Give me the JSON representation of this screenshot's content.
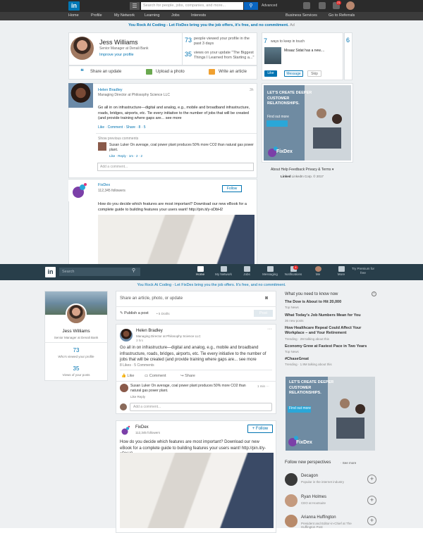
{
  "old": {
    "logo": "in",
    "search_placeholder": "Search for people, jobs, companies, and more...",
    "advanced": "Advanced",
    "nav": [
      "Home",
      "Profile",
      "My Network",
      "Learning",
      "Jobs",
      "Interests"
    ],
    "nav_right": [
      "Business Services",
      "Go to Referrals"
    ],
    "notif_count": "21",
    "promo": "You Rock At Coding - Let FixDex bring you the job offers, it's free, and no commitment.",
    "ad_label": "Ad",
    "profile": {
      "name": "Jess Williams",
      "title": "Senior Manager at Denali Bank",
      "improve": "Improve your profile",
      "stats": [
        {
          "n": "73",
          "t": "people viewed your profile in the past 3 days"
        },
        {
          "n": "35",
          "t": "views on your update \"The Biggest Things I Learned from Starting a...\""
        }
      ]
    },
    "actions": [
      "Share an update",
      "Upload a photo",
      "Write an article"
    ],
    "ways": {
      "n": "7",
      "t": "ways to keep in touch",
      "name": "Moaaz Sidat has a new....",
      "btns": [
        "Like",
        "Message",
        "Skip"
      ],
      "next": "6"
    },
    "post1": {
      "name": "Helen Bradley",
      "role": "Managing Director at Philosophy Science LLC",
      "time": "3h",
      "text": "Go all in on infrastructure—digital and analog, e.g., mobile and broadband infrastructure, roads, bridges, airports, etc. Tie every initiative to the number of jobs that will be created (and provide training where gaps are... see more",
      "meta": "Like  ·  Comment  ·  Share  ·  8  ·  5",
      "show_prev": "Show previous comments",
      "comment": "Susan Luker On average, coal power plant produces 50% more CO2 than natural gas power plant.",
      "comment_meta": "Like · Reply · 1m · 2 · 2",
      "add_comment": "Add a comment..."
    },
    "post2": {
      "name": "FixDex",
      "followers": "112,345 followers",
      "follow": "Follow",
      "text": "How do you decide which features are most important? Download our new eBook for a complete guide to building features your users want! http://pin.it/y-sDbH2"
    },
    "ad": {
      "line": "LET'S CREATE DEEPER CUSTOMER RELATIONSHIPS.",
      "cta": "Find out more",
      "brand": "FixDex"
    },
    "footer": "About   Help   Feedback   Privacy & Terms ▾",
    "copyright_logo": "Linked",
    "copyright": "LinkedIn Corp. © 2017"
  },
  "new": {
    "logo": "in",
    "search_placeholder": "Search",
    "nav": [
      "Home",
      "My Network",
      "Jobs",
      "Messaging",
      "Notifications",
      "Me",
      "More"
    ],
    "notif_count": "4",
    "premium": "Try Premium for free",
    "promo": "You Rock At Coding - Let FixDex bring you the job offers. It's free, and no commitment.",
    "profile": {
      "name": "Jess Williams",
      "title": "Senior Manager at Denali Bank",
      "stats": [
        {
          "n": "73",
          "t": "Who's viewed your profile"
        },
        {
          "n": "35",
          "t": "Views of your posts"
        }
      ]
    },
    "share": {
      "placeholder": "Share an article, photo, or update",
      "publish": "Publish a post",
      "drafts": "• 5 Drafts",
      "post": "Post"
    },
    "post1": {
      "name": "Helen Bradley",
      "role": "Managing Director at Philosophy Science LLC",
      "time": "3 hrs",
      "more": "···",
      "text": "Go all in on infrastructure—digital and analog, e.g., mobile and broadband infrastructure, roads, bridges, airports, etc. Tie every initiative to the number of jobs that will be created (and provide training where gaps are... see more",
      "meta": "8 Likes · 5 Comments",
      "actions": [
        "Like",
        "Comment",
        "Share"
      ],
      "comment": "Susan Luker On average, coal power plant produces 50% more CO2 than natural gas power plant.",
      "comment_time": "1 min  ···",
      "comment_meta": "Like   Reply",
      "add_comment": "Add a comment..."
    },
    "post2": {
      "name": "FixDex",
      "followers": "112,345 followers",
      "follow": "+ Follow",
      "text": "How do you decide which features are most important? Download our new eBook for a complete guide to building features your users want! http://pin.it/y-sDbH2"
    },
    "news": {
      "header": "What you need to know now",
      "info": "i",
      "items": [
        {
          "t": "The Dow is About to Hit 20,000",
          "s": "Top News"
        },
        {
          "t": "What Today's Job Numbers Mean for You",
          "s": "36 new posts"
        },
        {
          "t": "How Healthcare Repeal Could Affect Your Workplace – and Your Retirement",
          "s": "Trending · 2M talking about this"
        },
        {
          "t": "Economy Grew at Fastest Pace in Two Years",
          "s": "Top News"
        },
        {
          "t": "#ChaseGreat",
          "s": "Trending · 1.9M talking about this"
        }
      ]
    },
    "ad": {
      "line": "LET'S CREATE DEEPER CUSTOMER RELATIONSHIPS.",
      "cta": "Find out more",
      "brand": "FixDex"
    },
    "perspectives": {
      "header": "Follow new perspectives",
      "see_more": "· See more",
      "people": [
        {
          "name": "Decagon",
          "desc": "Popular in the internet industry"
        },
        {
          "name": "Ryan Holmes",
          "desc": "CEO at Hootsuite"
        },
        {
          "name": "Arianna Huffington",
          "desc": "President and Editor-in-Chief at The Huffington Post"
        }
      ]
    }
  },
  "colors": {
    "brand": "#0073b1",
    "old_bar": "#2b2b2b",
    "new_bar": "#283e4a",
    "notif": "#e02b2b"
  }
}
